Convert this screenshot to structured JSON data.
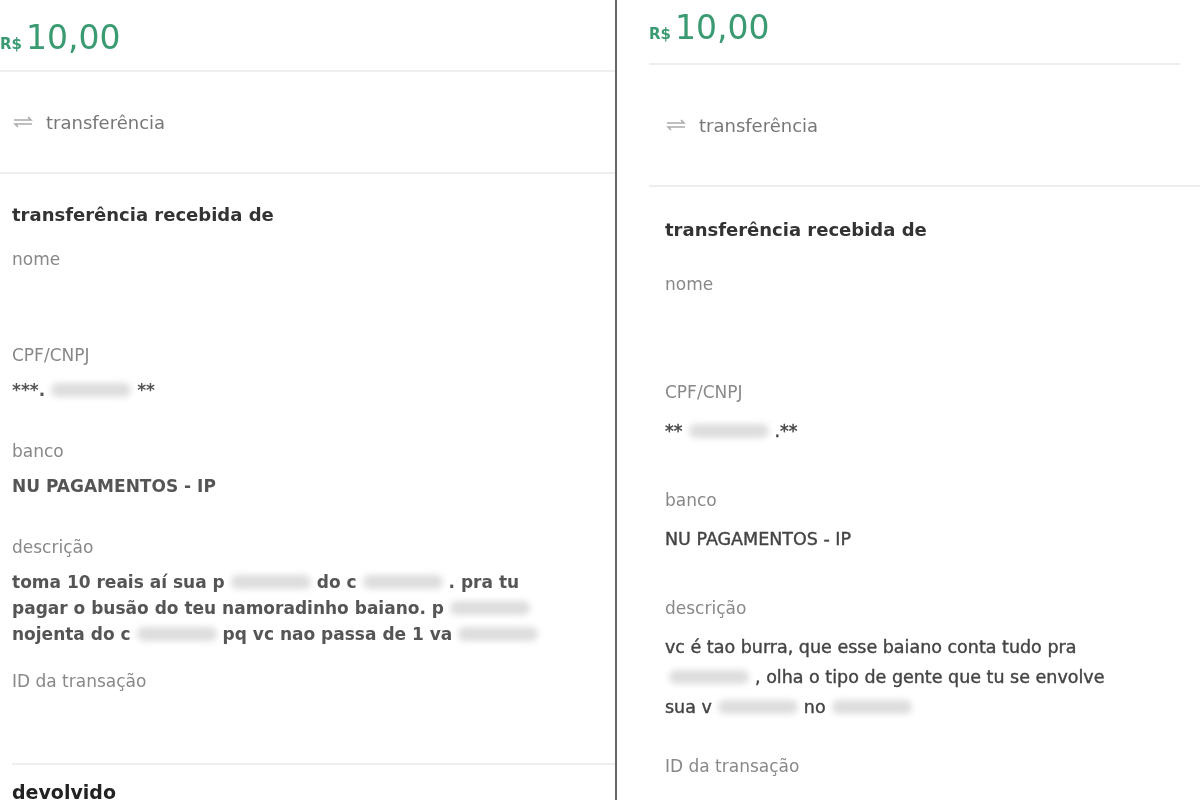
{
  "receipts": [
    {
      "amount": {
        "currency": "R$",
        "value": "10,00"
      },
      "type": "transferência",
      "section_title": "transferência recebida de",
      "fields": [
        {
          "label": "nome"
        },
        {
          "label": "CPF/CNPJ",
          "lines": [
            [
              {
                "kind": "text",
                "text": "***."
              },
              {
                "kind": "redacted"
              },
              {
                "kind": "text",
                "text": "**"
              }
            ]
          ]
        },
        {
          "label": "banco",
          "lines": [
            [
              {
                "kind": "text",
                "text": "NU PAGAMENTOS - IP"
              }
            ]
          ]
        },
        {
          "label": "descrição",
          "lines": [
            [
              {
                "kind": "text",
                "text": "toma 10 reais aí sua p"
              },
              {
                "kind": "redacted"
              },
              {
                "kind": "text",
                "text": "do c"
              },
              {
                "kind": "redacted"
              },
              {
                "kind": "text",
                "text": ". pra tu"
              }
            ],
            [
              {
                "kind": "text",
                "text": "pagar o busão do teu namoradinho baiano. p"
              },
              {
                "kind": "redacted"
              }
            ],
            [
              {
                "kind": "text",
                "text": "nojenta do c"
              },
              {
                "kind": "redacted"
              },
              {
                "kind": "text",
                "text": "pq vc nao passa de 1 va"
              },
              {
                "kind": "redacted"
              }
            ]
          ]
        },
        {
          "label": "ID da transação"
        }
      ],
      "footer_title": "devolvido"
    },
    {
      "amount": {
        "currency": "R$",
        "value": "10,00"
      },
      "type": "transferência",
      "section_title": "transferência recebida de",
      "fields": [
        {
          "label": "nome"
        },
        {
          "label": "CPF/CNPJ",
          "lines": [
            [
              {
                "kind": "text",
                "text": "**"
              },
              {
                "kind": "redacted"
              },
              {
                "kind": "text",
                "text": ".**"
              }
            ]
          ]
        },
        {
          "label": "banco",
          "lines": [
            [
              {
                "kind": "text",
                "text": "NU PAGAMENTOS - IP"
              }
            ]
          ]
        },
        {
          "label": "descrição",
          "lines": [
            [
              {
                "kind": "text",
                "text": "vc é tao burra, que esse baiano conta tudo pra"
              }
            ],
            [
              {
                "kind": "redacted"
              },
              {
                "kind": "text",
                "text": ", olha o tipo de gente que tu se envolve"
              }
            ],
            [
              {
                "kind": "text",
                "text": "sua v"
              },
              {
                "kind": "redacted"
              },
              {
                "kind": "text",
                "text": "no"
              },
              {
                "kind": "redacted"
              }
            ]
          ]
        },
        {
          "label": "ID da transação"
        }
      ]
    }
  ]
}
